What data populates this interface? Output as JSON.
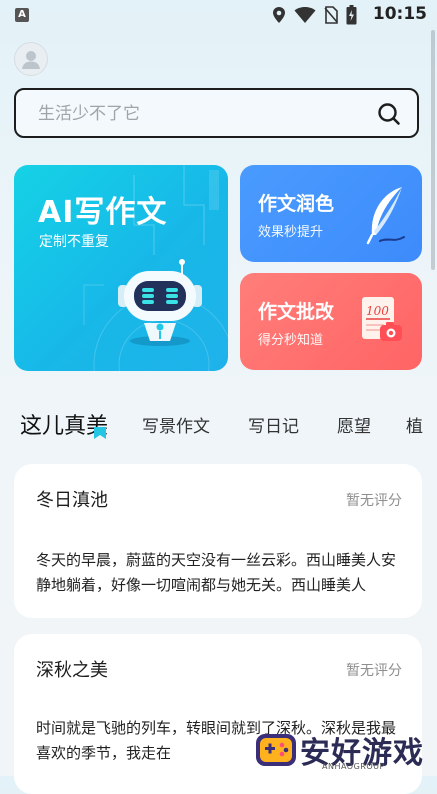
{
  "status_bar": {
    "time": "10:15",
    "notification_badge": "A",
    "icons": [
      "location-icon",
      "wifi-icon",
      "no-sim-icon",
      "battery-icon"
    ]
  },
  "search": {
    "placeholder": "生活少不了它"
  },
  "cards": {
    "ai_writing": {
      "title": "AI写作文",
      "subtitle": "定制不重复"
    },
    "polish": {
      "title": "作文润色",
      "subtitle": "效果秒提升"
    },
    "grading": {
      "title": "作文批改",
      "subtitle": "得分秒知道",
      "paper_score": "100"
    }
  },
  "tabs": [
    {
      "label": "这儿真美",
      "active": true
    },
    {
      "label": "写景作文"
    },
    {
      "label": "写日记"
    },
    {
      "label": "愿望"
    },
    {
      "label": "植"
    }
  ],
  "essays": [
    {
      "title": "冬日滇池",
      "rating": "暂无评分",
      "body": "冬天的早晨，蔚蓝的天空没有一丝云彩。西山睡美人安静地躺着，好像一切喧闹都与她无关。西山睡美人"
    },
    {
      "title": "深秋之美",
      "rating": "暂无评分",
      "body": "时间就是飞驰的列车，转眼间就到了深秋。深秋是我最喜欢的季节，我走在"
    }
  ],
  "watermark": {
    "text": "安好游戏",
    "sub": "ANHAOGROUP"
  },
  "colors": {
    "ai_card": "#17c4e8",
    "polish_card": "#4394fd",
    "grading_card": "#ff6e6c",
    "tab_marker": "#23c6e3"
  }
}
